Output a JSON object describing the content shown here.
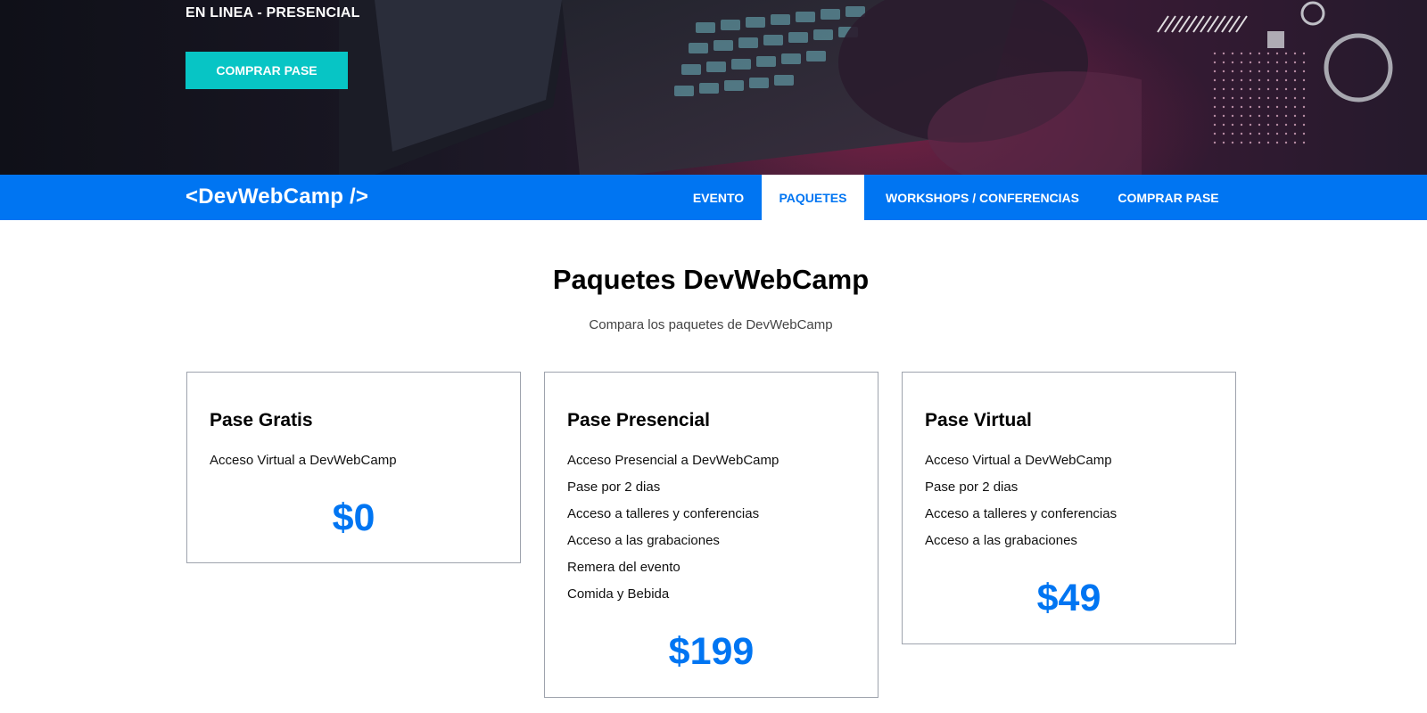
{
  "hero": {
    "kicker": "EN LINEA - PRESENCIAL",
    "cta_label": "COMPRAR PASE",
    "cta_color": "#07c5c5"
  },
  "navbar": {
    "logo": "<DevWebCamp />",
    "background": "#0075f2",
    "items": [
      {
        "label": "EVENTO",
        "active": false
      },
      {
        "label": "PAQUETES",
        "active": true
      },
      {
        "label": "WORKSHOPS / CONFERENCIAS",
        "active": false
      },
      {
        "label": "COMPRAR PASE",
        "active": false
      }
    ]
  },
  "section": {
    "title": "Paquetes DevWebCamp",
    "subtitle": "Compara los paquetes de DevWebCamp"
  },
  "packages": [
    {
      "name": "Pase Gratis",
      "features": [
        "Acceso Virtual a DevWebCamp"
      ],
      "price": "$0"
    },
    {
      "name": "Pase Presencial",
      "features": [
        "Acceso Presencial a DevWebCamp",
        "Pase por 2 dias",
        "Acceso a talleres y conferencias",
        "Acceso a las grabaciones",
        "Remera del evento",
        "Comida y Bebida"
      ],
      "price": "$199"
    },
    {
      "name": "Pase Virtual",
      "features": [
        "Acceso Virtual a DevWebCamp",
        "Pase por 2 dias",
        "Acceso a talleres y conferencias",
        "Acceso a las grabaciones"
      ],
      "price": "$49"
    }
  ],
  "colors": {
    "accent": "#0075f2",
    "card_border": "#9ea3ad"
  }
}
